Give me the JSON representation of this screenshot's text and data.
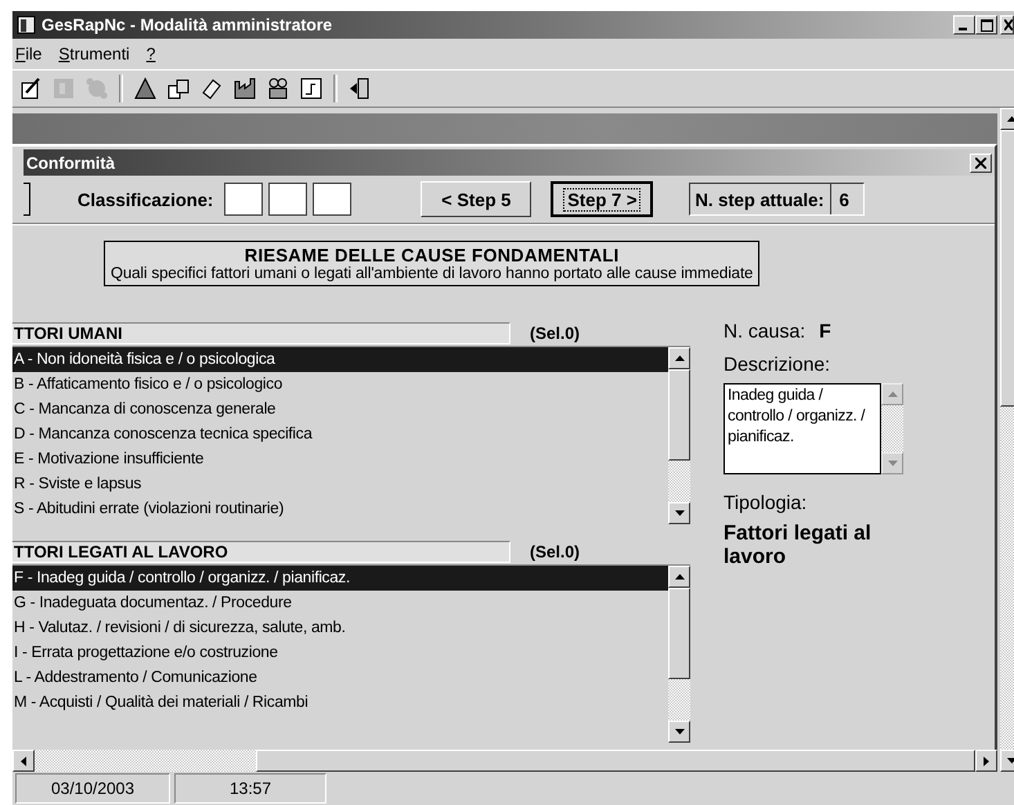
{
  "window": {
    "title": "GesRapNc - Modalità amministratore"
  },
  "menu": [
    {
      "label": "File"
    },
    {
      "label": "Strumenti"
    },
    {
      "label": "?"
    }
  ],
  "toolbar": {
    "groups": [
      [
        {
          "disabled": false
        },
        {
          "disabled": true
        },
        {
          "disabled": true
        }
      ],
      [
        {
          "disabled": false
        },
        {
          "disabled": false
        },
        {
          "disabled": false
        },
        {
          "disabled": false
        },
        {
          "disabled": false
        },
        {
          "disabled": false
        }
      ],
      [
        {
          "disabled": false
        }
      ]
    ]
  },
  "child_window": {
    "title": "Conformità"
  },
  "step_bar": {
    "classification_label": "Classificazione:",
    "prev_button": "< Step 5",
    "next_button": {
      "label": "Step 7 >",
      "focused": true
    },
    "current_step_label": "N. step attuale:",
    "current_step": "6"
  },
  "banner": {
    "title": "RIESAME DELLE CAUSE FONDAMENTALI",
    "subtitle": "Quali specifici fattori umani o legati all'ambiente di lavoro hanno portato alle cause immediate"
  },
  "lists": [
    {
      "header": "TTORI UMANI",
      "count": "(Sel.0)",
      "items": [
        {
          "label": "A - Non idoneità fisica e / o psicologica",
          "selected": true
        },
        {
          "label": "B - Affaticamento fisico e / o psicologico",
          "selected": false
        },
        {
          "label": "C - Mancanza di conoscenza generale",
          "selected": false
        },
        {
          "label": "D - Mancanza conoscenza tecnica specifica",
          "selected": false
        },
        {
          "label": "E - Motivazione insufficiente",
          "selected": false
        },
        {
          "label": "R - Sviste e lapsus",
          "selected": false
        },
        {
          "label": "S - Abitudini errate (violazioni routinarie)",
          "selected": false
        }
      ]
    },
    {
      "header": "TTORI LEGATI AL LAVORO",
      "count": "(Sel.0)",
      "items": [
        {
          "label": "F - Inadeg guida / controllo / organizz. / pianificaz.",
          "selected": true
        },
        {
          "label": "G - Inadeguata documentaz. / Procedure",
          "selected": false
        },
        {
          "label": "H - Valutaz. / revisioni /  di sicurezza, salute, amb.",
          "selected": false
        },
        {
          "label": "I - Errata progettazione e/o costruzione",
          "selected": false
        },
        {
          "label": "L - Addestramento / Comunicazione",
          "selected": false
        },
        {
          "label": "M - Acquisti / Qualità dei materiali / Ricambi",
          "selected": false
        }
      ]
    }
  ],
  "detail": {
    "cause_label": "N. causa:",
    "cause": "F",
    "description_label": "Descrizione:",
    "description": "Inadeg guida / controllo / organizz. / pianificaz.",
    "type_label": "Tipologia:",
    "type": "Fattori legati al lavoro"
  },
  "status_bar": [
    "03/10/2003",
    "13:57"
  ]
}
